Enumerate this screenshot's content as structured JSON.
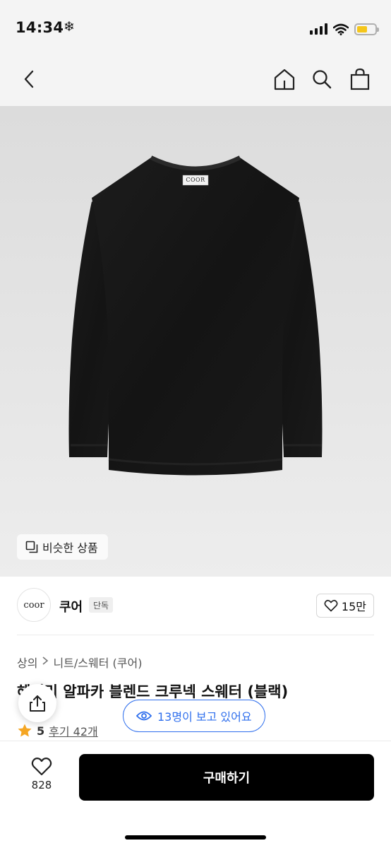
{
  "status_bar": {
    "time": "14:34",
    "snow_icon": "❄",
    "battery_color": "#f5c61b",
    "battery_level": 0.6
  },
  "nav": {
    "back_icon": "chevron-left-icon",
    "home_icon": "home-icon",
    "search_icon": "search-icon",
    "bag_icon": "shopping-bag-icon"
  },
  "hero": {
    "garment_label": "COOR",
    "similar_label": "비슷한 상품"
  },
  "brand": {
    "logo_text": "coor",
    "name": "쿠어",
    "badge": "단독",
    "like_count": "15만"
  },
  "breadcrumb": {
    "category": "상의",
    "subcategory": "니트/스웨터 (쿠어)"
  },
  "product": {
    "title": "헤더리 알파카 블렌드 크루넥 스웨터 (블랙)",
    "rating": "5",
    "review_label": "후기 42개",
    "star_color": "#f5a623"
  },
  "overlay": {
    "viewers_text": "13명이 보고 있어요",
    "accent_color": "#2f6fed"
  },
  "bottom_bar": {
    "like_count": "828",
    "buy_label": "구매하기"
  }
}
